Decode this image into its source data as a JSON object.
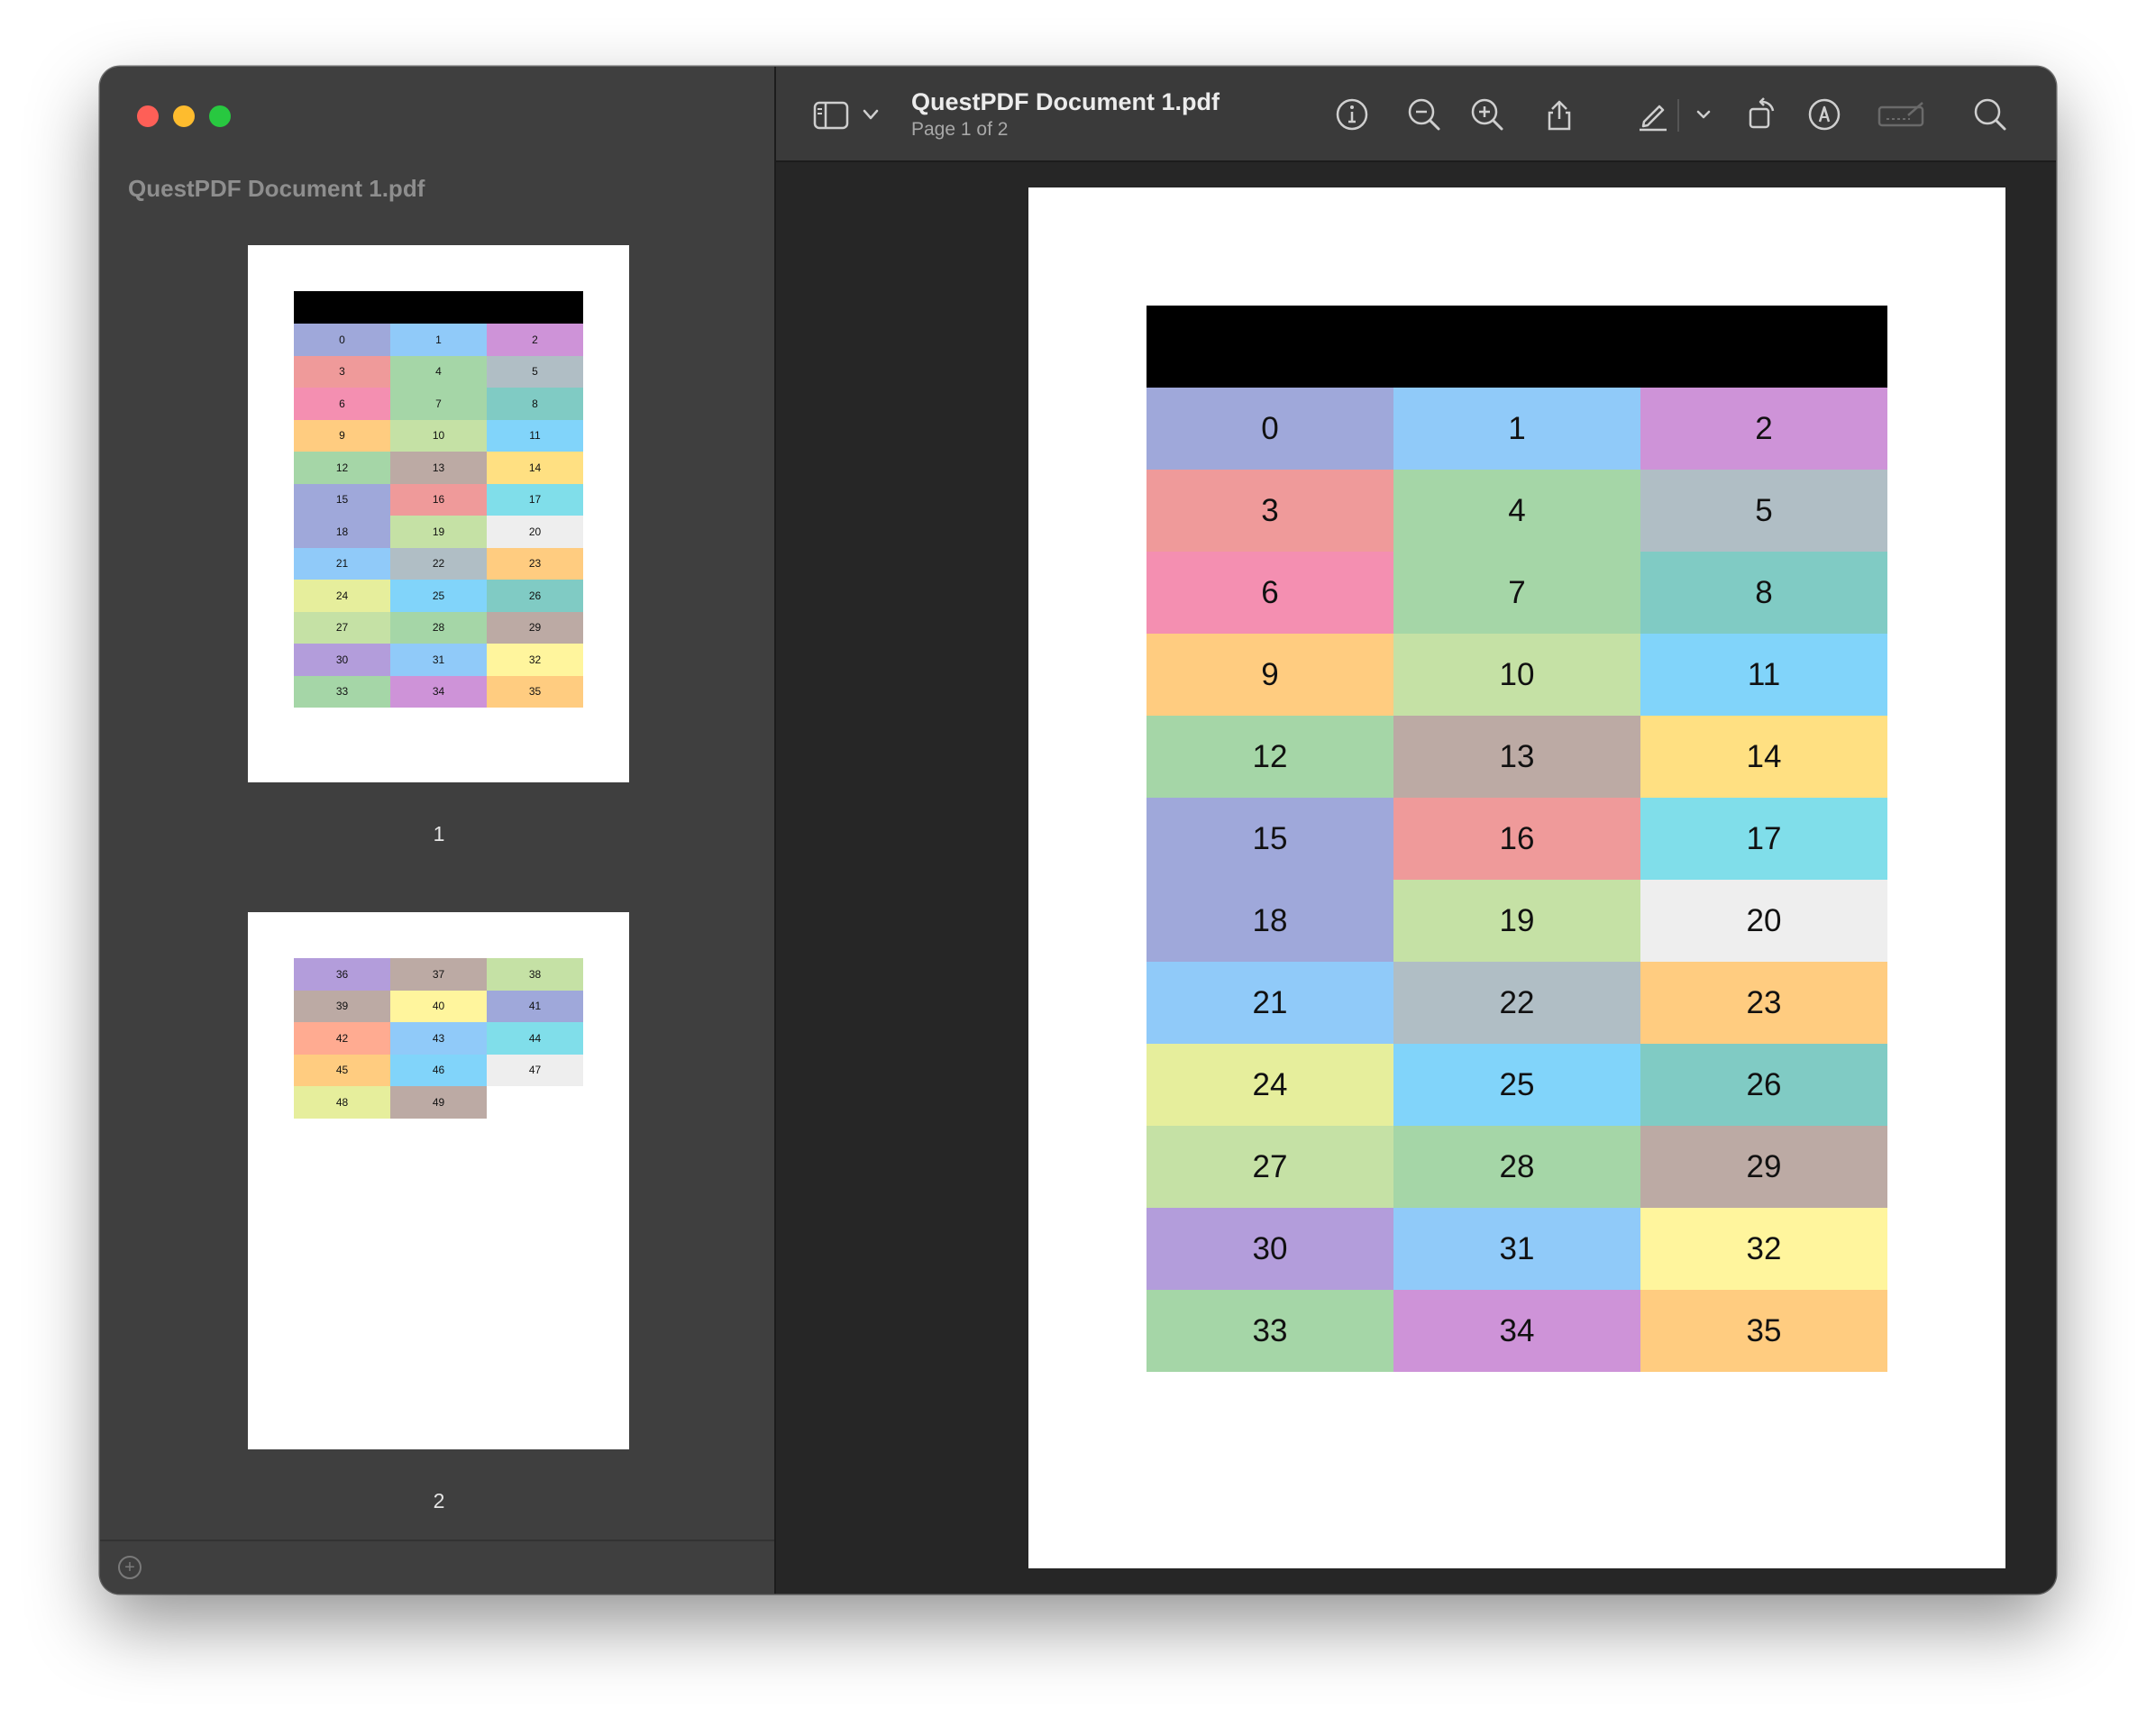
{
  "window": {
    "file_name": "QuestPDF Document 1.pdf",
    "page_indicator": "Page 1 of 2"
  },
  "sidebar": {
    "title": "QuestPDF Document 1.pdf",
    "thumbnails": [
      {
        "label": "1"
      },
      {
        "label": "2"
      }
    ],
    "add_icon": "plus-circle-icon"
  },
  "toolbar": {
    "icons": [
      "sidebar-toggle-icon",
      "chevron-down-icon",
      "info-icon",
      "zoom-out-icon",
      "zoom-in-icon",
      "share-icon",
      "highlight-pen-icon",
      "chevron-down-icon",
      "rotate-icon",
      "markup-icon",
      "signature-icon",
      "search-icon"
    ]
  },
  "document": {
    "page1_cells": [
      {
        "v": "0",
        "c": "#9fa8da"
      },
      {
        "v": "1",
        "c": "#90caf9"
      },
      {
        "v": "2",
        "c": "#ce93d8"
      },
      {
        "v": "3",
        "c": "#ef9a9a"
      },
      {
        "v": "4",
        "c": "#a5d6a7"
      },
      {
        "v": "5",
        "c": "#b0bec5"
      },
      {
        "v": "6",
        "c": "#f48fb1"
      },
      {
        "v": "7",
        "c": "#a5d6a7"
      },
      {
        "v": "8",
        "c": "#80cbc4"
      },
      {
        "v": "9",
        "c": "#ffcc80"
      },
      {
        "v": "10",
        "c": "#c5e1a5"
      },
      {
        "v": "11",
        "c": "#81d4fa"
      },
      {
        "v": "12",
        "c": "#a5d6a7"
      },
      {
        "v": "13",
        "c": "#bcaaa4"
      },
      {
        "v": "14",
        "c": "#ffe082"
      },
      {
        "v": "15",
        "c": "#9fa8da"
      },
      {
        "v": "16",
        "c": "#ef9a9a"
      },
      {
        "v": "17",
        "c": "#80deea"
      },
      {
        "v": "18",
        "c": "#9fa8da"
      },
      {
        "v": "19",
        "c": "#c5e1a5"
      },
      {
        "v": "20",
        "c": "#eeeeee"
      },
      {
        "v": "21",
        "c": "#90caf9"
      },
      {
        "v": "22",
        "c": "#b0bec5"
      },
      {
        "v": "23",
        "c": "#ffcc80"
      },
      {
        "v": "24",
        "c": "#e6ee9c"
      },
      {
        "v": "25",
        "c": "#81d4fa"
      },
      {
        "v": "26",
        "c": "#80cbc4"
      },
      {
        "v": "27",
        "c": "#c5e1a5"
      },
      {
        "v": "28",
        "c": "#a5d6a7"
      },
      {
        "v": "29",
        "c": "#bcaaa4"
      },
      {
        "v": "30",
        "c": "#b39ddb"
      },
      {
        "v": "31",
        "c": "#90caf9"
      },
      {
        "v": "32",
        "c": "#fff59d"
      },
      {
        "v": "33",
        "c": "#a5d6a7"
      },
      {
        "v": "34",
        "c": "#ce93d8"
      },
      {
        "v": "35",
        "c": "#ffcc80"
      }
    ],
    "page2_cells": [
      {
        "v": "36",
        "c": "#b39ddb"
      },
      {
        "v": "37",
        "c": "#bcaaa4"
      },
      {
        "v": "38",
        "c": "#c5e1a5"
      },
      {
        "v": "39",
        "c": "#bcaaa4"
      },
      {
        "v": "40",
        "c": "#fff59d"
      },
      {
        "v": "41",
        "c": "#9fa8da"
      },
      {
        "v": "42",
        "c": "#ffab91"
      },
      {
        "v": "43",
        "c": "#90caf9"
      },
      {
        "v": "44",
        "c": "#80deea"
      },
      {
        "v": "45",
        "c": "#ffcc80"
      },
      {
        "v": "46",
        "c": "#81d4fa"
      },
      {
        "v": "47",
        "c": "#eeeeee"
      },
      {
        "v": "48",
        "c": "#e6ee9c"
      },
      {
        "v": "49",
        "c": "#bcaaa4"
      }
    ]
  }
}
